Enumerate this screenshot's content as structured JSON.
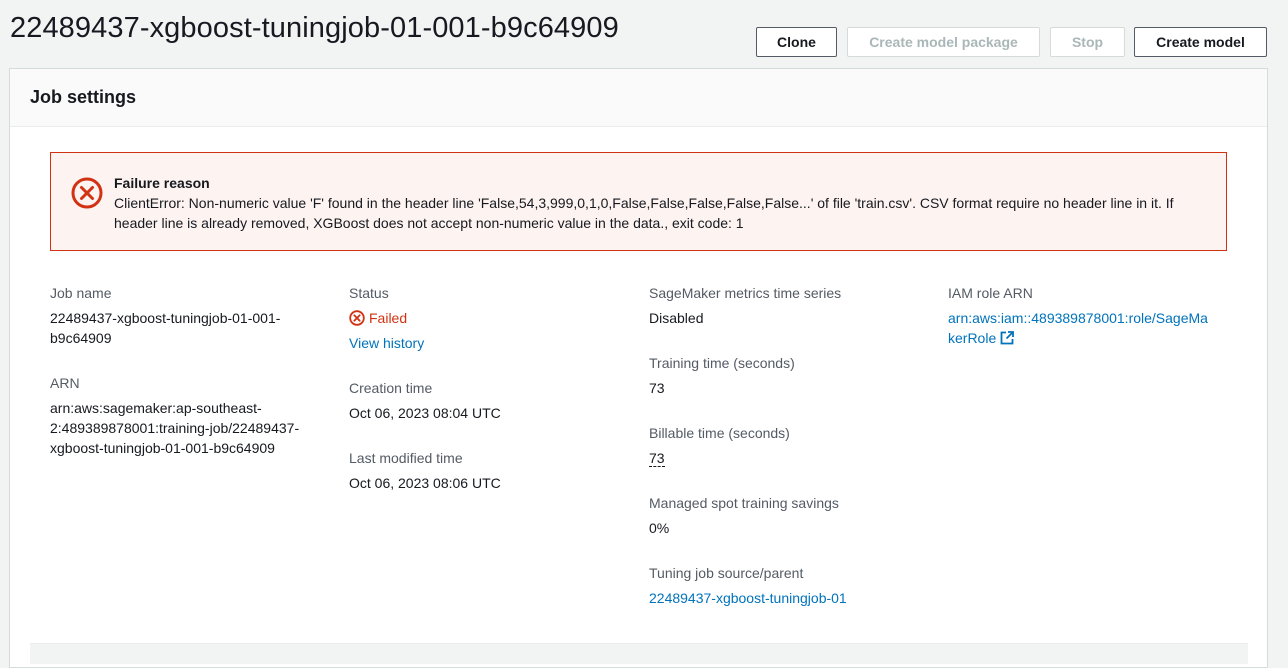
{
  "page": {
    "title": "22489437-xgboost-tuningjob-01-001-b9c64909"
  },
  "actions": {
    "clone": "Clone",
    "create_model_package": "Create model package",
    "stop": "Stop",
    "create_model": "Create model"
  },
  "panel": {
    "title": "Job settings"
  },
  "alert": {
    "header": "Failure reason",
    "body": "ClientError: Non-numeric value 'F' found in the header line 'False,54,3,999,0,1,0,False,False,False,False,False...' of file 'train.csv'. CSV format require no header line in it. If header line is already removed, XGBoost does not accept non-numeric value in the data., exit code: 1"
  },
  "details": {
    "job_name_label": "Job name",
    "job_name_line1": "22489437-xgboost-tuningjob-01-001-",
    "job_name_line2": "b9c64909",
    "arn_label": "ARN",
    "arn_line1": "arn:aws:sagemaker:ap-southeast-",
    "arn_line2": "2:489389878001:training-job/22489437-",
    "arn_line3": "xgboost-tuningjob-01-001-b9c64909",
    "status_label": "Status",
    "status_value": "Failed",
    "view_history": "View history",
    "creation_time_label": "Creation time",
    "creation_time_value": "Oct 06, 2023 08:04 UTC",
    "last_modified_label": "Last modified time",
    "last_modified_value": "Oct 06, 2023 08:06 UTC",
    "metrics_label": "SageMaker metrics time series",
    "metrics_value": "Disabled",
    "training_time_label": "Training time (seconds)",
    "training_time_value": "73",
    "billable_time_label": "Billable time (seconds)",
    "billable_time_value": "73",
    "spot_savings_label": "Managed spot training savings",
    "spot_savings_value": "0%",
    "tuning_source_label": "Tuning job source/parent",
    "tuning_source_value": "22489437-xgboost-tuningjob-01",
    "iam_role_label": "IAM role ARN",
    "iam_role_line1": "arn:aws:iam::489389878001:role/SageMa",
    "iam_role_line2": "kerRole"
  },
  "colors": {
    "error": "#d13212",
    "link": "#0073bb",
    "alert_bg": "#fdf3f1"
  },
  "icons": {
    "alert": "error-circle-icon",
    "status": "status-failed-icon",
    "external": "external-link-icon"
  }
}
